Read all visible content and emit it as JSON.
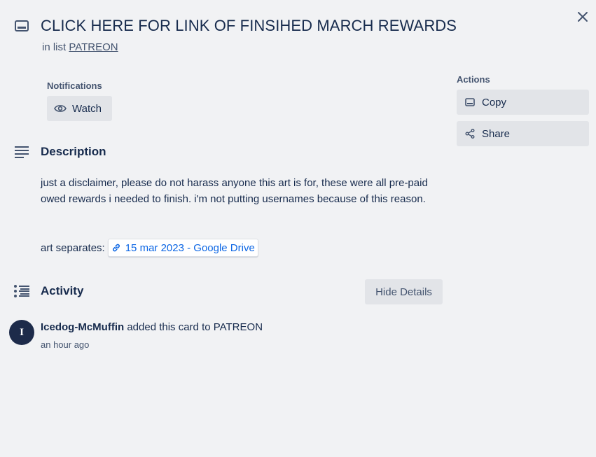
{
  "card": {
    "title": "CLICK HERE FOR LINK OF FINSIHED MARCH REWARDS",
    "in_list_prefix": "in list",
    "list_name": "PATREON"
  },
  "notifications": {
    "label": "Notifications",
    "watch_label": "Watch"
  },
  "actions": {
    "label": "Actions",
    "copy_label": "Copy",
    "share_label": "Share"
  },
  "description": {
    "heading": "Description",
    "body": "just a disclaimer, please do not harass anyone this art is for, these were all pre-paid owed rewards i needed to finish. i'm not putting usernames because of this reason.",
    "separates_prefix": "art separates:",
    "link_text": "15 mar 2023 - Google Drive"
  },
  "activity": {
    "heading": "Activity",
    "hide_details_label": "Hide Details",
    "entries": [
      {
        "avatar_initial": "I",
        "user": "Icedog-McMuffin",
        "action": "added this card to PATREON",
        "time": "an hour ago"
      }
    ]
  },
  "icons": {
    "card": "card-icon",
    "close": "close-icon",
    "eye": "eye-icon",
    "copy": "copy-icon",
    "share": "share-icon",
    "description": "description-icon",
    "link": "link-icon",
    "activity": "activity-icon"
  },
  "colors": {
    "background": "#f1f2f4",
    "button": "#e2e4e8",
    "text": "#172b4d",
    "subtle_text": "#44546f",
    "link": "#0c66e4",
    "avatar": "#1d2b4a"
  }
}
